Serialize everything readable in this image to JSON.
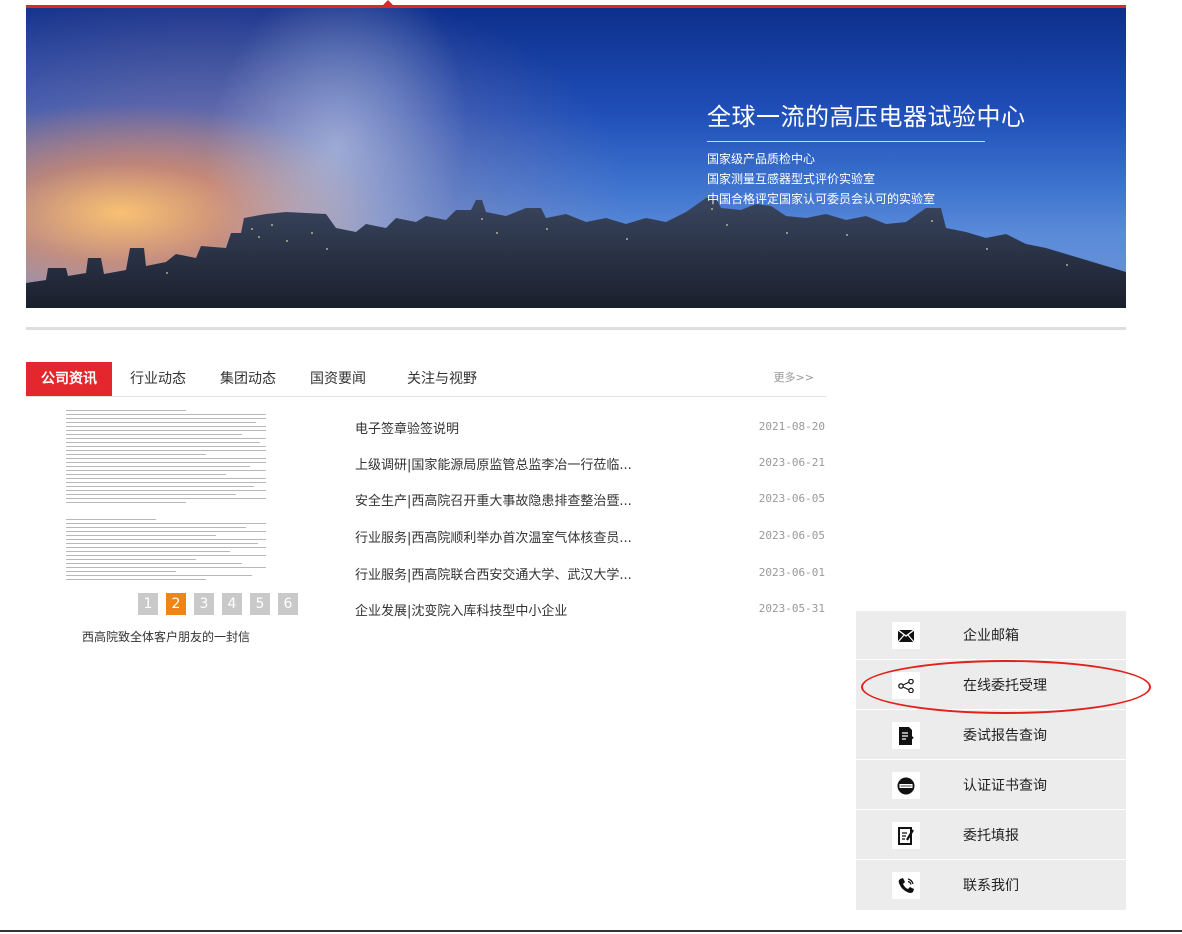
{
  "banner": {
    "title": "全球一流的高压电器试验中心",
    "lines": [
      "国家级产品质检中心",
      "国家测量互感器型式评价实验室",
      "中国合格评定国家认可委员会认可的实验室"
    ]
  },
  "news": {
    "tabs": [
      {
        "label": "公司资讯",
        "active": true
      },
      {
        "label": "行业动态",
        "active": false
      },
      {
        "label": "集团动态",
        "active": false
      },
      {
        "label": "国资要闻",
        "active": false
      },
      {
        "label": "关注与视野",
        "active": false
      }
    ],
    "more_label": "更多>>",
    "featured": {
      "caption": "西高院致全体客户朋友的一封信",
      "pages": [
        "1",
        "2",
        "3",
        "4",
        "5",
        "6"
      ],
      "active_page": "2"
    },
    "items": [
      {
        "title": "电子签章验签说明",
        "date": "2021-08-20"
      },
      {
        "title": "上级调研|国家能源局原监管总监李冶一行莅临...",
        "date": "2023-06-21"
      },
      {
        "title": "安全生产|西高院召开重大事故隐患排查整治暨...",
        "date": "2023-06-05"
      },
      {
        "title": "行业服务|西高院顺利举办首次温室气体核查员...",
        "date": "2023-06-05"
      },
      {
        "title": "行业服务|西高院联合西安交通大学、武汉大学...",
        "date": "2023-06-01"
      },
      {
        "title": "企业发展|沈变院入库科技型中小企业",
        "date": "2023-05-31"
      }
    ]
  },
  "quick_links": [
    {
      "label": "企业邮箱",
      "icon": "mail-icon"
    },
    {
      "label": "在线委托受理",
      "icon": "share-icon"
    },
    {
      "label": "委试报告查询",
      "icon": "report-icon"
    },
    {
      "label": "认证证书查询",
      "icon": "certificate-icon"
    },
    {
      "label": "委托填报",
      "icon": "form-edit-icon"
    },
    {
      "label": "联系我们",
      "icon": "phone-icon"
    }
  ],
  "colors": {
    "accent_red": "#e3272d",
    "pager_active": "#f08513",
    "panel_bg": "#ececec"
  }
}
